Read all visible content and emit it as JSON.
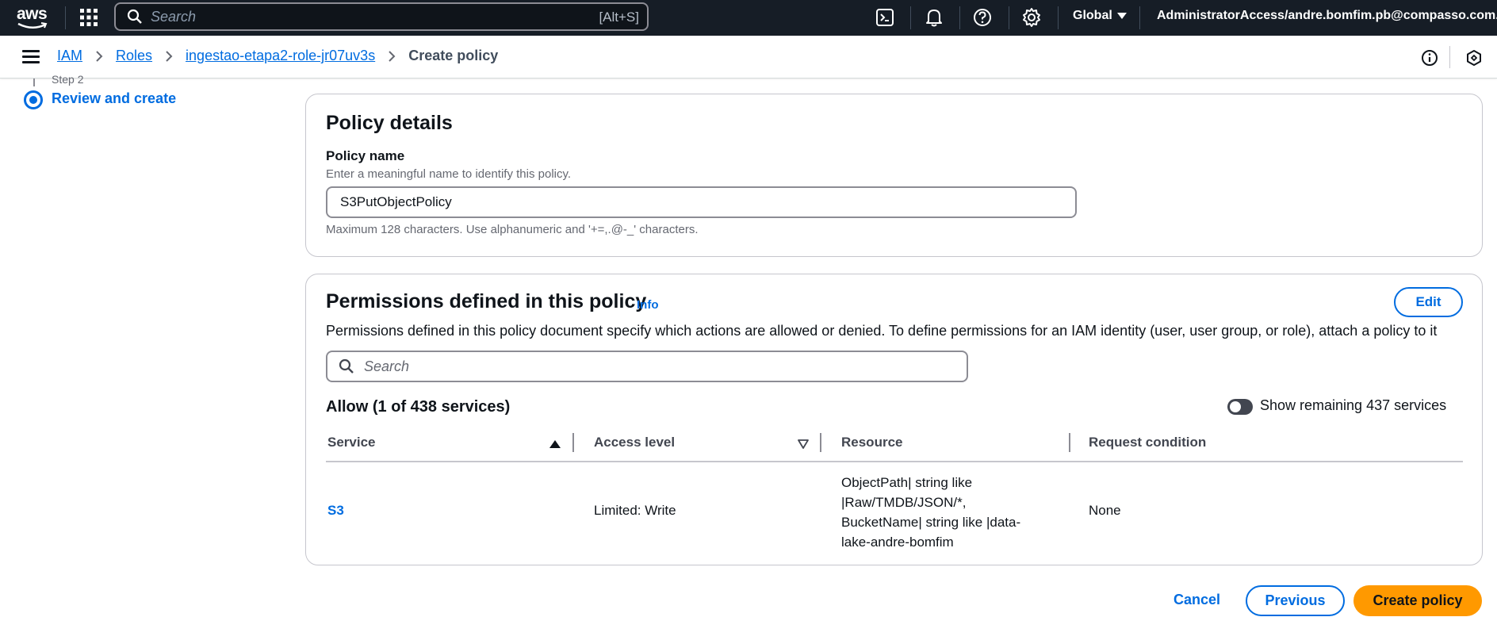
{
  "topnav": {
    "logo_text": "aws",
    "search_placeholder": "Search",
    "search_shortcut": "[Alt+S]",
    "region": "Global",
    "account": "AdministratorAccess/andre.bomfim.pb@compasso.com.br"
  },
  "breadcrumb": {
    "items": [
      "IAM",
      "Roles",
      "ingestao-etapa2-role-jr07uv3s"
    ],
    "current": "Create policy"
  },
  "steps": {
    "step_label": "Step 2",
    "step_title": "Review and create"
  },
  "policy_details": {
    "title": "Policy details",
    "name_label": "Policy name",
    "name_description": "Enter a meaningful name to identify this policy.",
    "name_value": "S3PutObjectPolicy",
    "name_constraint": "Maximum 128 characters. Use alphanumeric and '+=,.@-_' characters."
  },
  "permissions": {
    "title": "Permissions defined in this policy",
    "info_label": "Info",
    "edit_label": "Edit",
    "description": "Permissions defined in this policy document specify which actions are allowed or denied. To define permissions for an IAM identity (user, user group, or role), attach a policy to it",
    "search_placeholder": "Search",
    "allow_title": "Allow (1 of 438 services)",
    "toggle_label": "Show remaining 437 services",
    "columns": [
      "Service",
      "Access level",
      "Resource",
      "Request condition"
    ],
    "rows": [
      {
        "service": "S3",
        "access_level": "Limited: Write",
        "resource": "ObjectPath| string like |Raw/TMDB/JSON/*, BucketName| string like |data-lake-andre-bomfim",
        "request_condition": "None"
      }
    ]
  },
  "footer": {
    "cancel_label": "Cancel",
    "previous_label": "Previous",
    "create_label": "Create policy"
  },
  "colors": {
    "nav_bg": "#161d26",
    "link_blue": "#006ce0",
    "primary_orange": "#ff9900"
  }
}
